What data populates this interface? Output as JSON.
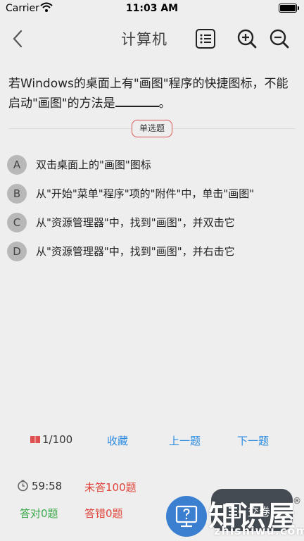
{
  "status_bar": {
    "carrier": "Carrier",
    "time": "11:03 AM"
  },
  "nav": {
    "title": "计算机",
    "icons": {
      "back": "chevron-left-icon",
      "list": "list-icon",
      "zoom_in": "zoom-in-icon",
      "zoom_out": "zoom-out-icon"
    }
  },
  "question": {
    "text": "若Windows的桌面上有\"画图\"程序的快捷图标，不能启动\"画图\"的方法是",
    "suffix": "。",
    "type": "单选题"
  },
  "options": [
    {
      "letter": "A",
      "text": "双击桌面上的\"画图\"图标"
    },
    {
      "letter": "B",
      "text": "从\"开始\"菜单\"程序\"项的\"附件\"中，单击\"画图\""
    },
    {
      "letter": "C",
      "text": "从\"资源管理器\"中，找到\"画图\"，并双击它"
    },
    {
      "letter": "D",
      "text": "从\"资源管理器\"中，找到\"画图\"，并右击它"
    }
  ],
  "bottom_nav": {
    "progress": "1/100",
    "favorite": "收藏",
    "prev": "上一题",
    "next": "下一题"
  },
  "stats": {
    "timer": "59:58",
    "unanswered": "未答100题",
    "correct": "答对0题",
    "wrong": "答错0题"
  },
  "actions": {
    "submit": "交卷"
  },
  "watermark": {
    "main": "知识屋",
    "reg": "®",
    "sub": "zhishiwu.com"
  },
  "colors": {
    "accent_blue": "#2b8be0",
    "error_red": "#e0443a",
    "success_green": "#3aa84a",
    "background": "#eeeeee"
  }
}
